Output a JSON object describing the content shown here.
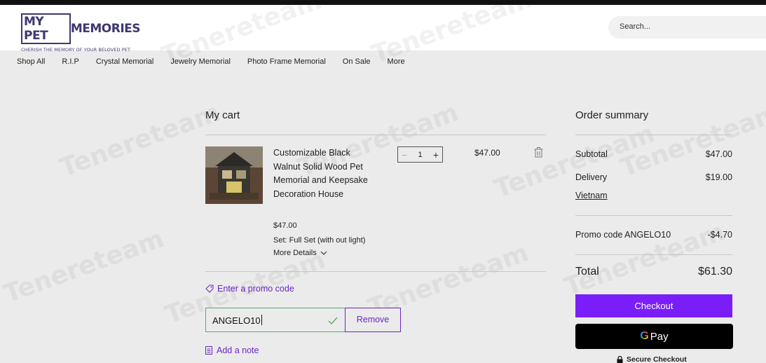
{
  "brand": {
    "logo_word_1": "MY PET",
    "logo_word_2": "MEMORIES",
    "tagline": "CHERISH THE MEMORY OF YOUR BELOVED PET"
  },
  "search": {
    "placeholder": "Search..."
  },
  "nav": {
    "items": [
      "Shop All",
      "R.I.P",
      "Crystal Memorial",
      "Jewelry Memorial",
      "Photo Frame Memorial",
      "On Sale",
      "More"
    ]
  },
  "cart": {
    "title": "My cart",
    "item": {
      "name": "Customizable Black Walnut Solid Wood Pet Memorial and Keepsake Decoration House",
      "price": "$47.00",
      "option": "Set: Full Set (with out light)",
      "more_details": "More Details",
      "quantity": "1",
      "line_total": "$47.00",
      "image_icon": "product-photo"
    },
    "promo_link": "Enter a promo code",
    "promo_value": "ANGELO10",
    "remove_label": "Remove",
    "note_link": "Add a note"
  },
  "summary": {
    "title": "Order summary",
    "subtotal_label": "Subtotal",
    "subtotal_value": "$47.00",
    "delivery_label": "Delivery",
    "delivery_value": "$19.00",
    "delivery_country": "Vietnam",
    "promo_label": "Promo code ANGELO10",
    "promo_value": "-$4.70",
    "total_label": "Total",
    "total_value": "$61.30",
    "checkout_label": "Checkout",
    "gpay_label": "Pay",
    "secure_label": "Secure Checkout"
  },
  "watermark": {
    "text": "Tenereteam"
  },
  "colors": {
    "accent": "#7a1ef9",
    "link": "#6a27c4",
    "brand": "#3e3870",
    "valid": "#5aa872"
  }
}
